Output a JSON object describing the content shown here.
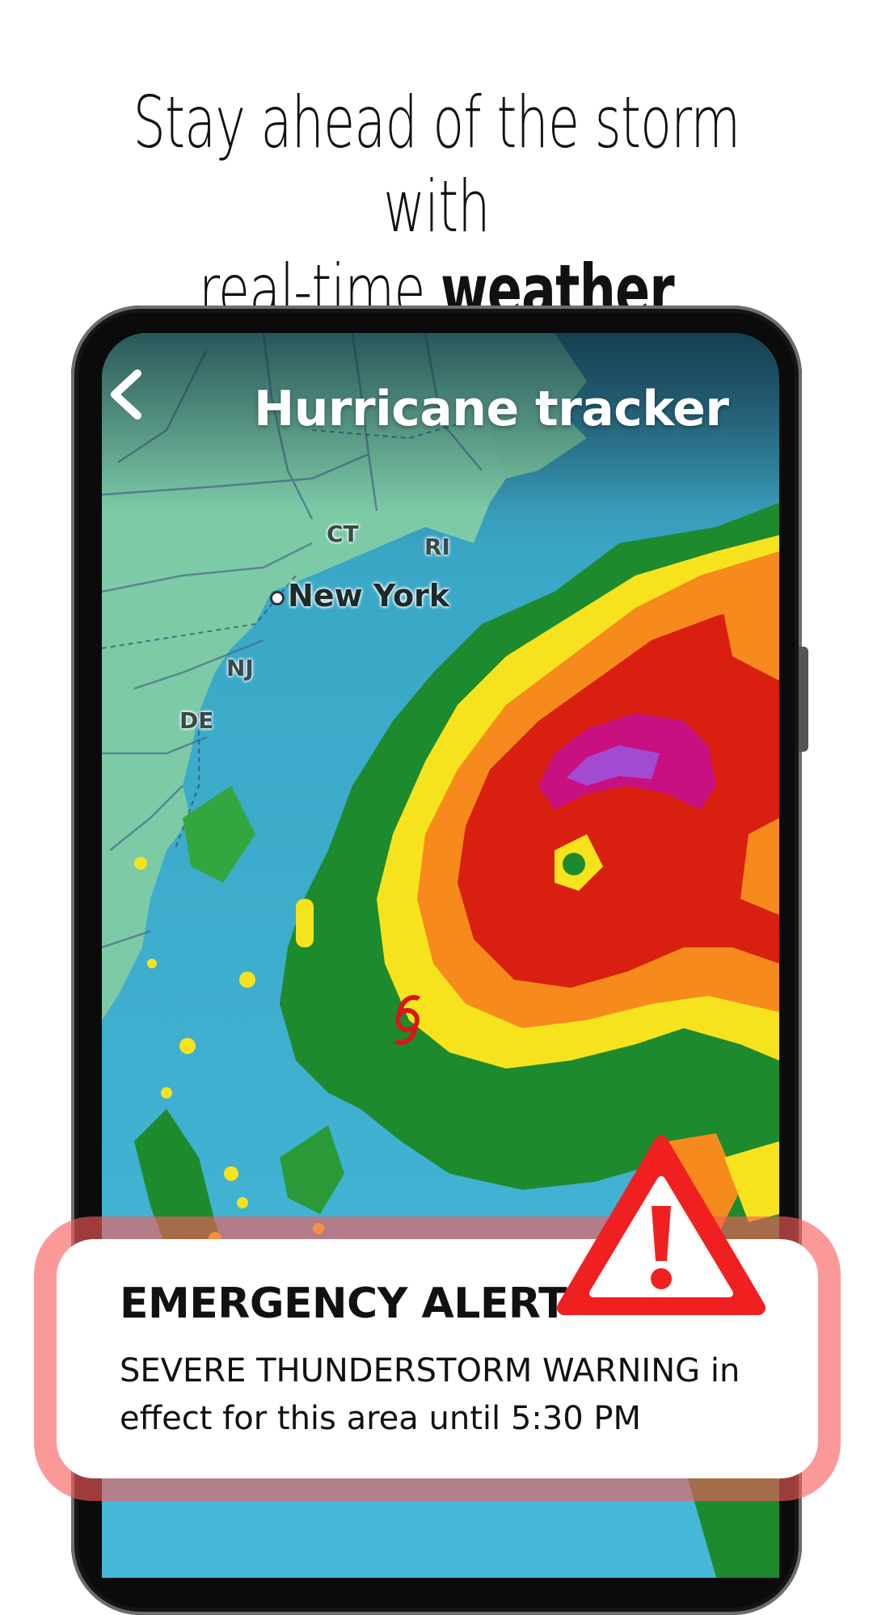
{
  "headline": {
    "line1": "Stay ahead of the storm with",
    "line2_light": "real-time ",
    "line2_bold": "weather radar"
  },
  "app_bar": {
    "back_icon": "chevron-left-icon",
    "title": "Hurricane tracker"
  },
  "map": {
    "state_labels": [
      "CT",
      "RI",
      "NJ",
      "DE"
    ],
    "city": "New York",
    "storm_marker_icon": "hurricane-icon"
  },
  "alert": {
    "icon": "warning-triangle-icon",
    "title": "EMERGENCY ALERT",
    "message": "SEVERE THUNDERSTORM WARNING in effect for this area until 5:30 PM"
  },
  "colors": {
    "ocean": "#3fb3d3",
    "land": "#7ccaa6",
    "radar_green": "#1e8a2e",
    "radar_yellow": "#f6e31e",
    "radar_orange": "#f78a1c",
    "radar_red": "#d92010",
    "radar_magenta": "#d73a9a",
    "alert_red": "#f85a5a"
  }
}
